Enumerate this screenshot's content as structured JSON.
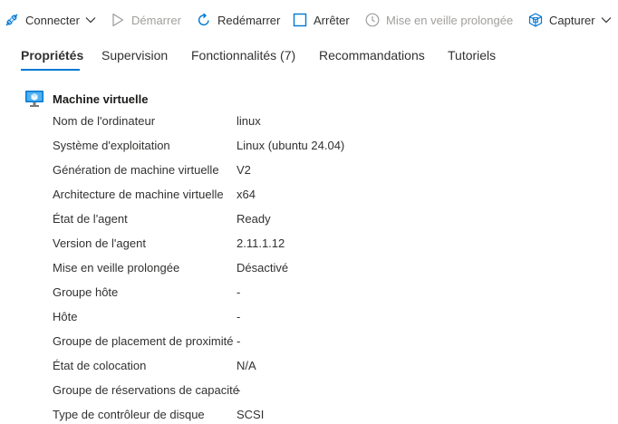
{
  "toolbar": {
    "connect_label": "Connecter",
    "start_label": "Démarrer",
    "restart_label": "Redémarrer",
    "stop_label": "Arrêter",
    "hibernate_label": "Mise en veille prolongée",
    "capture_label": "Capturer"
  },
  "tabs": [
    {
      "label": "Propriétés",
      "active": true
    },
    {
      "label": "Supervision",
      "active": false
    },
    {
      "label": "Fonctionnalités (7)",
      "active": false
    },
    {
      "label": "Recommandations",
      "active": false
    },
    {
      "label": "Tutoriels",
      "active": false
    }
  ],
  "section": {
    "title": "Machine virtuelle",
    "icon": "virtual-machine-icon"
  },
  "properties": [
    {
      "label": "Nom de l'ordinateur",
      "value": "linux"
    },
    {
      "label": "Système d'exploitation",
      "value": "Linux (ubuntu 24.04)"
    },
    {
      "label": "Génération de machine virtuelle",
      "value": "V2"
    },
    {
      "label": "Architecture de machine virtuelle",
      "value": "x64"
    },
    {
      "label": "État de l'agent",
      "value": "Ready"
    },
    {
      "label": "Version de l'agent",
      "value": "2.11.1.12"
    },
    {
      "label": "Mise en veille prolongée",
      "value": "Désactivé"
    },
    {
      "label": "Groupe hôte",
      "value": "-"
    },
    {
      "label": "Hôte",
      "value": "-"
    },
    {
      "label": "Groupe de placement de proximité",
      "value": "-"
    },
    {
      "label": "État de colocation",
      "value": "N/A"
    },
    {
      "label": "Groupe de réservations de capacité",
      "value": "-"
    },
    {
      "label": "Type de contrôleur de disque",
      "value": "SCSI"
    }
  ],
  "colors": {
    "accent": "#0078d4",
    "text": "#323130",
    "disabled_text": "#a19f9d"
  }
}
